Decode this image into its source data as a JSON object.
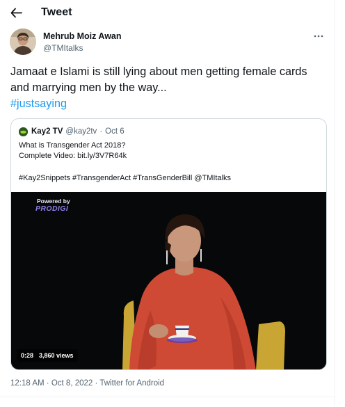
{
  "header": {
    "title": "Tweet",
    "back_icon": "arrow-left-icon"
  },
  "tweet": {
    "author_name": "Mehrub Moiz Awan",
    "author_handle": "@TMItalks",
    "more_icon": "more-dots-icon",
    "text": "Jamaat e Islami is still lying about men getting female cards and marrying men by the way...",
    "hashtag": "#justsaying",
    "time": "12:18 AM",
    "date": "Oct 8, 2022",
    "source": "Twitter for Android",
    "separator": "·"
  },
  "quote": {
    "name": "Kay2 TV",
    "handle": "@kay2tv",
    "separator": "·",
    "date": "Oct 6",
    "line1": "What is Transgender Act 2018?",
    "line2": "Complete Video: bit.ly/3V7R64k",
    "line3": "#Kay2Snippets #TransgenderAct #TransGenderBill  @TMItalks",
    "video": {
      "watermark_top": "Powered by",
      "watermark_brand": "PRODIGI",
      "duration": "0:28",
      "views": "3,860 views"
    }
  },
  "colors": {
    "accent": "#1d9bf0",
    "text": "#0f1419",
    "muted": "#536471",
    "border": "#cfd9de"
  }
}
